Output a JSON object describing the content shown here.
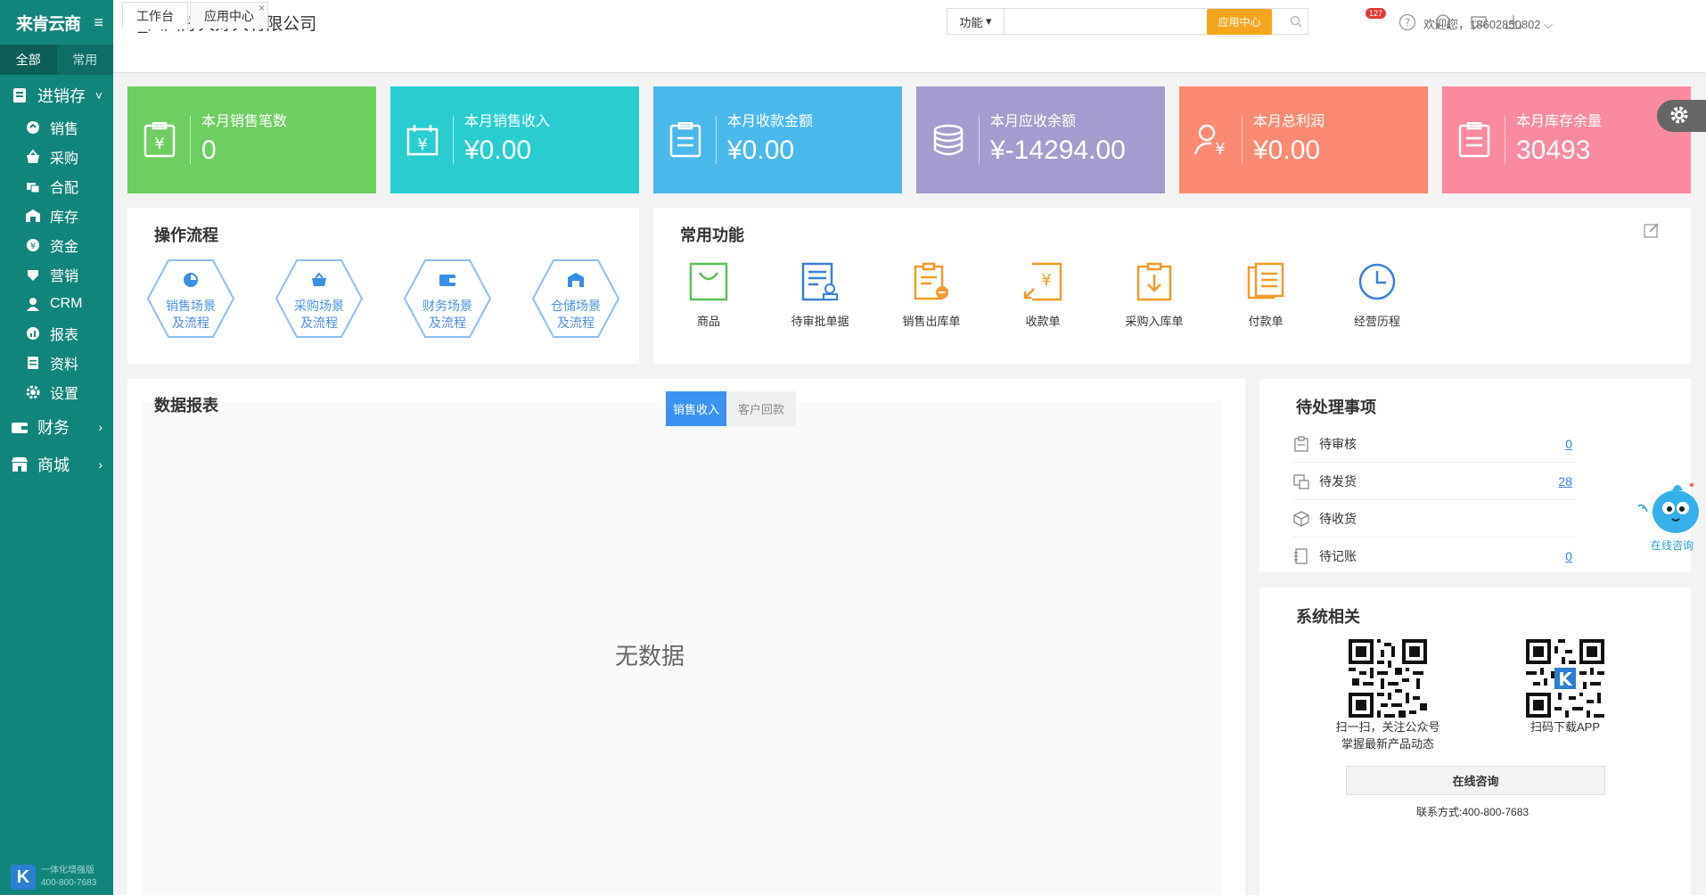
{
  "sidebar": {
    "logo": "来肯云商",
    "tabs": [
      "全部",
      "常用"
    ],
    "group_main": "进销存",
    "items": [
      {
        "label": "销售",
        "icon": "sales-icon"
      },
      {
        "label": "采购",
        "icon": "purchase-icon"
      },
      {
        "label": "合配",
        "icon": "allocation-icon"
      },
      {
        "label": "库存",
        "icon": "warehouse-icon"
      },
      {
        "label": "资金",
        "icon": "money-icon"
      },
      {
        "label": "营销",
        "icon": "marketing-icon"
      },
      {
        "label": "CRM",
        "icon": "crm-icon"
      },
      {
        "label": "报表",
        "icon": "report-icon"
      },
      {
        "label": "资料",
        "icon": "data-icon"
      },
      {
        "label": "设置",
        "icon": "settings-icon"
      }
    ],
    "group_finance": "财务",
    "group_mall": "商城",
    "footer_line1": "一体化增强版",
    "footer_line2": "400-800-7683"
  },
  "header": {
    "company": "lk_四川好大好大有限公司",
    "search_select": "功能",
    "search_placeholder": "",
    "app_center_button": "应用中心",
    "notification_count": "127",
    "welcome": "欢迎您，18602850802"
  },
  "tabs": [
    {
      "label": "工作台"
    },
    {
      "label": "应用中心"
    }
  ],
  "stat_cards": [
    {
      "label": "本月销售笔数",
      "value": "0",
      "color": "#6ccf5f"
    },
    {
      "label": "本月销售收入",
      "value": "¥0.00",
      "color": "#2acdcf"
    },
    {
      "label": "本月收款金额",
      "value": "¥0.00",
      "color": "#4ab8ea"
    },
    {
      "label": "本月应收余额",
      "value": "¥-14294.00",
      "color": "#a49ccf"
    },
    {
      "label": "本月总利润",
      "value": "¥0.00",
      "color": "#fb8a70"
    },
    {
      "label": "本月库存余量",
      "value": "30493",
      "color": "#fa8aa0"
    }
  ],
  "workflow": {
    "title": "操作流程",
    "items": [
      {
        "line1": "销售场景",
        "line2": "及流程"
      },
      {
        "line1": "采购场景",
        "line2": "及流程"
      },
      {
        "line1": "财务场景",
        "line2": "及流程"
      },
      {
        "line1": "仓储场景",
        "line2": "及流程"
      }
    ]
  },
  "common_functions": {
    "title": "常用功能",
    "items": [
      {
        "label": "商品",
        "icon": "product-bag-icon"
      },
      {
        "label": "待审批单据",
        "icon": "approval-doc-icon"
      },
      {
        "label": "销售出库单",
        "icon": "sales-outbound-icon"
      },
      {
        "label": "收款单",
        "icon": "receipt-icon"
      },
      {
        "label": "采购入库单",
        "icon": "purchase-inbound-icon"
      },
      {
        "label": "付款单",
        "icon": "payment-icon"
      },
      {
        "label": "经营历程",
        "icon": "clock-icon"
      }
    ]
  },
  "report": {
    "title": "数据报表",
    "tabs": [
      "销售收入",
      "客户回款"
    ],
    "empty_text": "无数据"
  },
  "todo": {
    "title": "待处理事项",
    "items": [
      {
        "label": "待审核",
        "value": "0"
      },
      {
        "label": "待发货",
        "value": "28"
      },
      {
        "label": "待收货",
        "value": ""
      },
      {
        "label": "待记账",
        "value": "0"
      }
    ]
  },
  "system": {
    "title": "系统相关",
    "qr1_caption_line1": "扫一扫，关注公众号",
    "qr1_caption_line2": "掌握最新产品动态",
    "qr2_caption": "扫码下载APP",
    "consult_button": "在线咨询",
    "contact": "联系方式:400-800-7683"
  },
  "float_consult": "在线咨询",
  "colors": {
    "sidebar": "#12857a",
    "accent_orange": "#f7a51c",
    "tab_blue": "#3a93f0"
  }
}
